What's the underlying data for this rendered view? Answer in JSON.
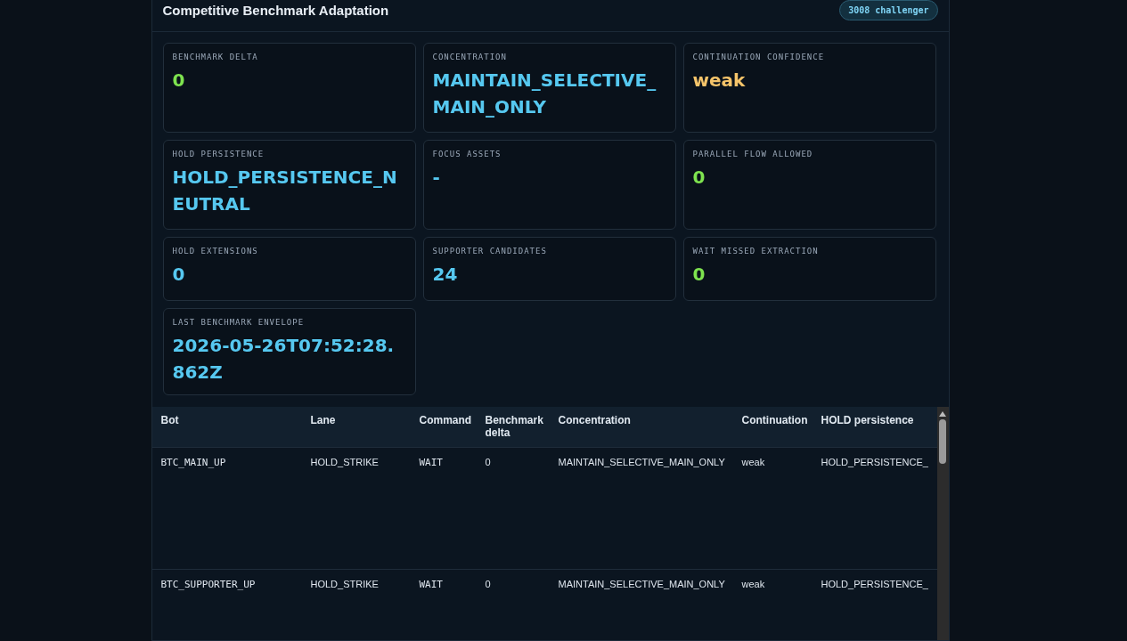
{
  "panel": {
    "title": "Competitive Benchmark Adaptation",
    "badge": "3008 challenger"
  },
  "cards": [
    {
      "label": "BENCHMARK DELTA",
      "value": "0",
      "color": "#7ee34f"
    },
    {
      "label": "CONCENTRATION",
      "value": "MAINTAIN_SELECTIVE_MAIN_ONLY",
      "color": "#56c8f0"
    },
    {
      "label": "CONTINUATION CONFIDENCE",
      "value": "weak",
      "color": "#f5c46a"
    },
    {
      "label": "HOLD PERSISTENCE",
      "value": "HOLD_PERSISTENCE_NEUTRAL",
      "color": "#56c8f0"
    },
    {
      "label": "FOCUS ASSETS",
      "value": "-",
      "color": "#56c8f0"
    },
    {
      "label": "PARALLEL FLOW ALLOWED",
      "value": "0",
      "color": "#7ee34f"
    },
    {
      "label": "HOLD EXTENSIONS",
      "value": "0",
      "color": "#56c8f0"
    },
    {
      "label": "SUPPORTER CANDIDATES",
      "value": "24",
      "color": "#56c8f0"
    },
    {
      "label": "WAIT MISSED EXTRACTION",
      "value": "0",
      "color": "#7ee34f"
    },
    {
      "label": "LAST BENCHMARK ENVELOPE",
      "value": "2026-05-26T07:52:28.862Z",
      "color": "#56c8f0"
    }
  ],
  "table": {
    "columns": [
      "Bot",
      "Lane",
      "Command",
      "Benchmark delta",
      "Concentration",
      "Continuation",
      "HOLD persistence"
    ],
    "rows": [
      [
        "BTC_MAIN_UP",
        "HOLD_STRIKE",
        "WAIT",
        "0",
        "MAINTAIN_SELECTIVE_MAIN_ONLY",
        "weak",
        "HOLD_PERSISTENCE_"
      ],
      [
        "BTC_SUPPORTER_UP",
        "HOLD_STRIKE",
        "WAIT",
        "0",
        "MAINTAIN_SELECTIVE_MAIN_ONLY",
        "weak",
        "HOLD_PERSISTENCE_"
      ]
    ]
  }
}
